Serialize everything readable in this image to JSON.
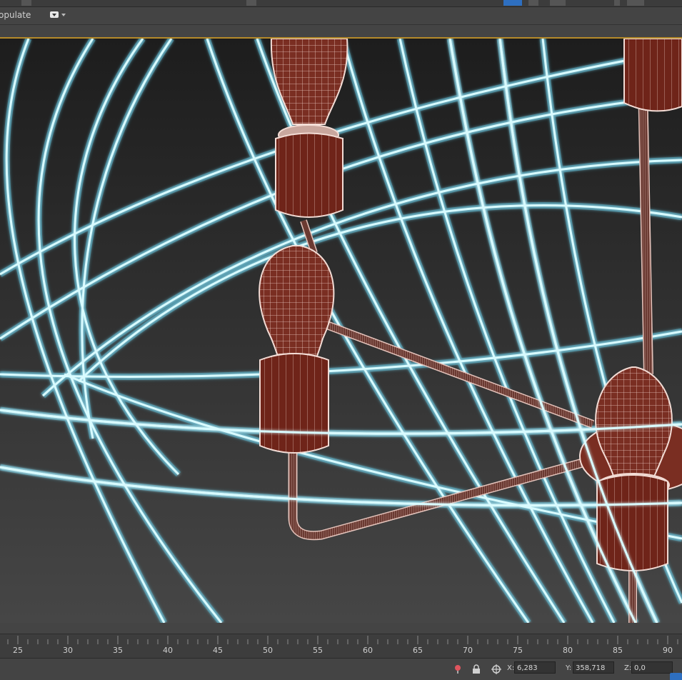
{
  "ribbon": {
    "populate_label": "opulate"
  },
  "timeline": {
    "ticks": [
      "25",
      "30",
      "35",
      "40",
      "45",
      "50",
      "55",
      "60",
      "65",
      "70",
      "75",
      "80",
      "85",
      "90"
    ]
  },
  "status": {
    "x_label": "X:",
    "x_value": "6,283",
    "y_label": "Y:",
    "y_value": "358,718",
    "z_label": "Z:",
    "z_value": "0,0"
  },
  "icons": {
    "marker": "pin-icon",
    "lock": "lock-icon",
    "mode": "absolute-mode-icon"
  },
  "colors": {
    "viewport_border": "#b58a2a",
    "wire": "#bff4ff",
    "wire_glow": "#3fb9d6",
    "mesh_fill": "#7a2e22",
    "mesh_line": "#e8c9c0"
  }
}
